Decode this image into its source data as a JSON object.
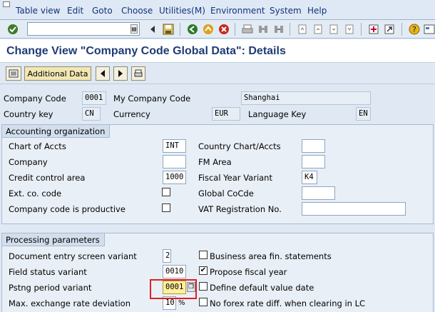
{
  "menu": [
    "Table view",
    "Edit",
    "Goto",
    "Choose",
    "Utilities(M)",
    "Environment",
    "System",
    "Help"
  ],
  "toolbar": {
    "command_value": "",
    "icons": [
      "enter-icon",
      "save-icon",
      "back-icon",
      "exit-icon",
      "cancel-icon",
      "print-icon",
      "find-icon",
      "find-next-icon",
      "first-page-icon",
      "previous-page-icon",
      "next-page-icon",
      "last-page-icon",
      "new-session-icon",
      "shortcut-icon",
      "help-icon",
      "layout-icon"
    ]
  },
  "title": "Change View \"Company Code Global Data\": Details",
  "app_toolbar": {
    "additional_data_label": "Additional Data"
  },
  "header": {
    "company_code_label": "Company Code",
    "company_code_value": "0001",
    "company_name_label": "My Company Code",
    "city_value": "Shanghai",
    "country_key_label": "Country key",
    "country_key_value": "CN",
    "currency_label": "Currency",
    "currency_value": "EUR",
    "language_key_label": "Language Key",
    "language_key_value": "EN"
  },
  "accounting": {
    "title": "Accounting organization",
    "chart_of_accts_label": "Chart of Accts",
    "chart_of_accts_value": "INT",
    "country_chart_label": "Country Chart/Accts",
    "country_chart_value": "",
    "company_label": "Company",
    "company_value": "",
    "fm_area_label": "FM Area",
    "fm_area_value": "",
    "credit_control_label": "Credit control area",
    "credit_control_value": "1000",
    "fiscal_year_variant_label": "Fiscal Year Variant",
    "fiscal_year_variant_value": "K4",
    "ext_co_code_label": "Ext. co. code",
    "ext_co_code_checked": false,
    "global_cocode_label": "Global CoCde",
    "global_cocode_value": "",
    "productive_label": "Company code is productive",
    "productive_checked": false,
    "vat_reg_label": "VAT Registration No.",
    "vat_reg_value": ""
  },
  "processing": {
    "title": "Processing parameters",
    "doc_entry_label": "Document entry screen variant",
    "doc_entry_value": "2",
    "business_area_label": "Business area fin. statements",
    "business_area_checked": false,
    "field_status_label": "Field status variant",
    "field_status_value": "0010",
    "propose_fy_label": "Propose fiscal year",
    "propose_fy_checked": true,
    "posting_period_label": "Pstng period variant",
    "posting_period_value": "0001",
    "default_value_date_label": "Define default value date",
    "default_value_date_checked": false,
    "max_exch_label": "Max. exchange rate deviation",
    "max_exch_value": "10",
    "max_exch_unit": "%",
    "no_forex_label": "No forex rate diff. when clearing in LC",
    "no_forex_checked": false
  },
  "colors": {
    "title": "#1f3c74",
    "menu_text": "#12327a",
    "selection": "#ffef9e",
    "highlight": "#e02020"
  }
}
